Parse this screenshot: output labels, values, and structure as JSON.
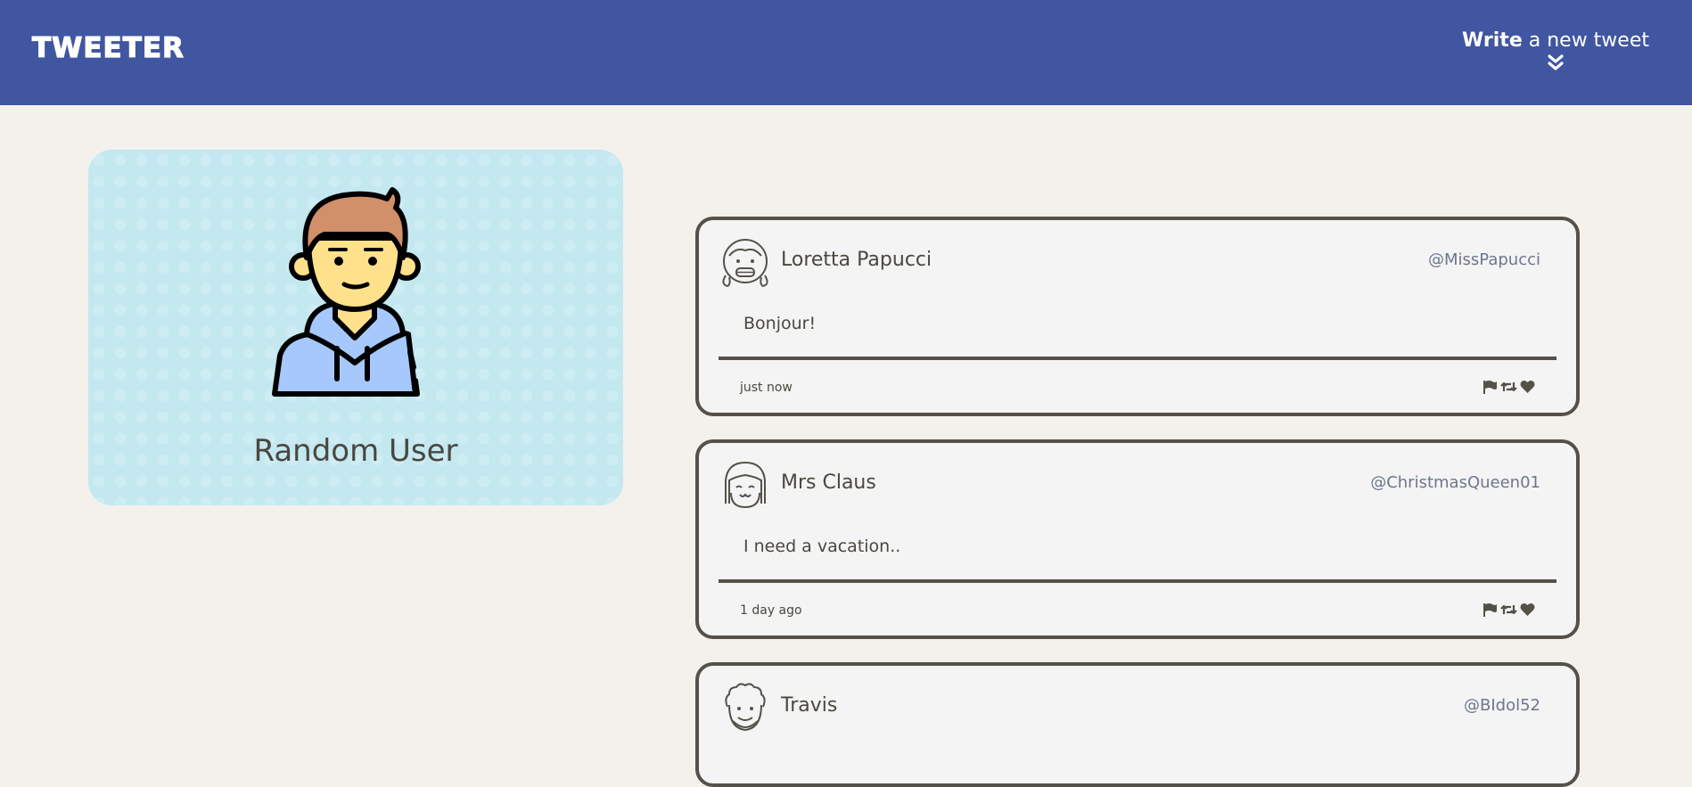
{
  "nav": {
    "logo": "TWEETER",
    "compose_bold": "Write",
    "compose_rest": " a new tweet"
  },
  "profile": {
    "name": "Random User"
  },
  "tweets": [
    {
      "name": "Loretta Papucci",
      "handle": "@MissPapucci",
      "text": "Bonjour!",
      "time": "just now"
    },
    {
      "name": "Mrs Claus",
      "handle": "@ChristmasQueen01",
      "text": "I need a vacation..",
      "time": "1 day ago"
    },
    {
      "name": "Travis",
      "handle": "@BIdol52"
    }
  ],
  "icons": {
    "compose": "double-chevron-down-icon",
    "flag": "flag-icon",
    "retweet": "retweet-icon",
    "like": "heart-icon"
  },
  "colors": {
    "nav": "#4056a1",
    "page": "#f4f1ec",
    "profile_card": "#c3e8f0",
    "text": "#4a473f",
    "handle": "#6d7690",
    "border": "#545149"
  }
}
